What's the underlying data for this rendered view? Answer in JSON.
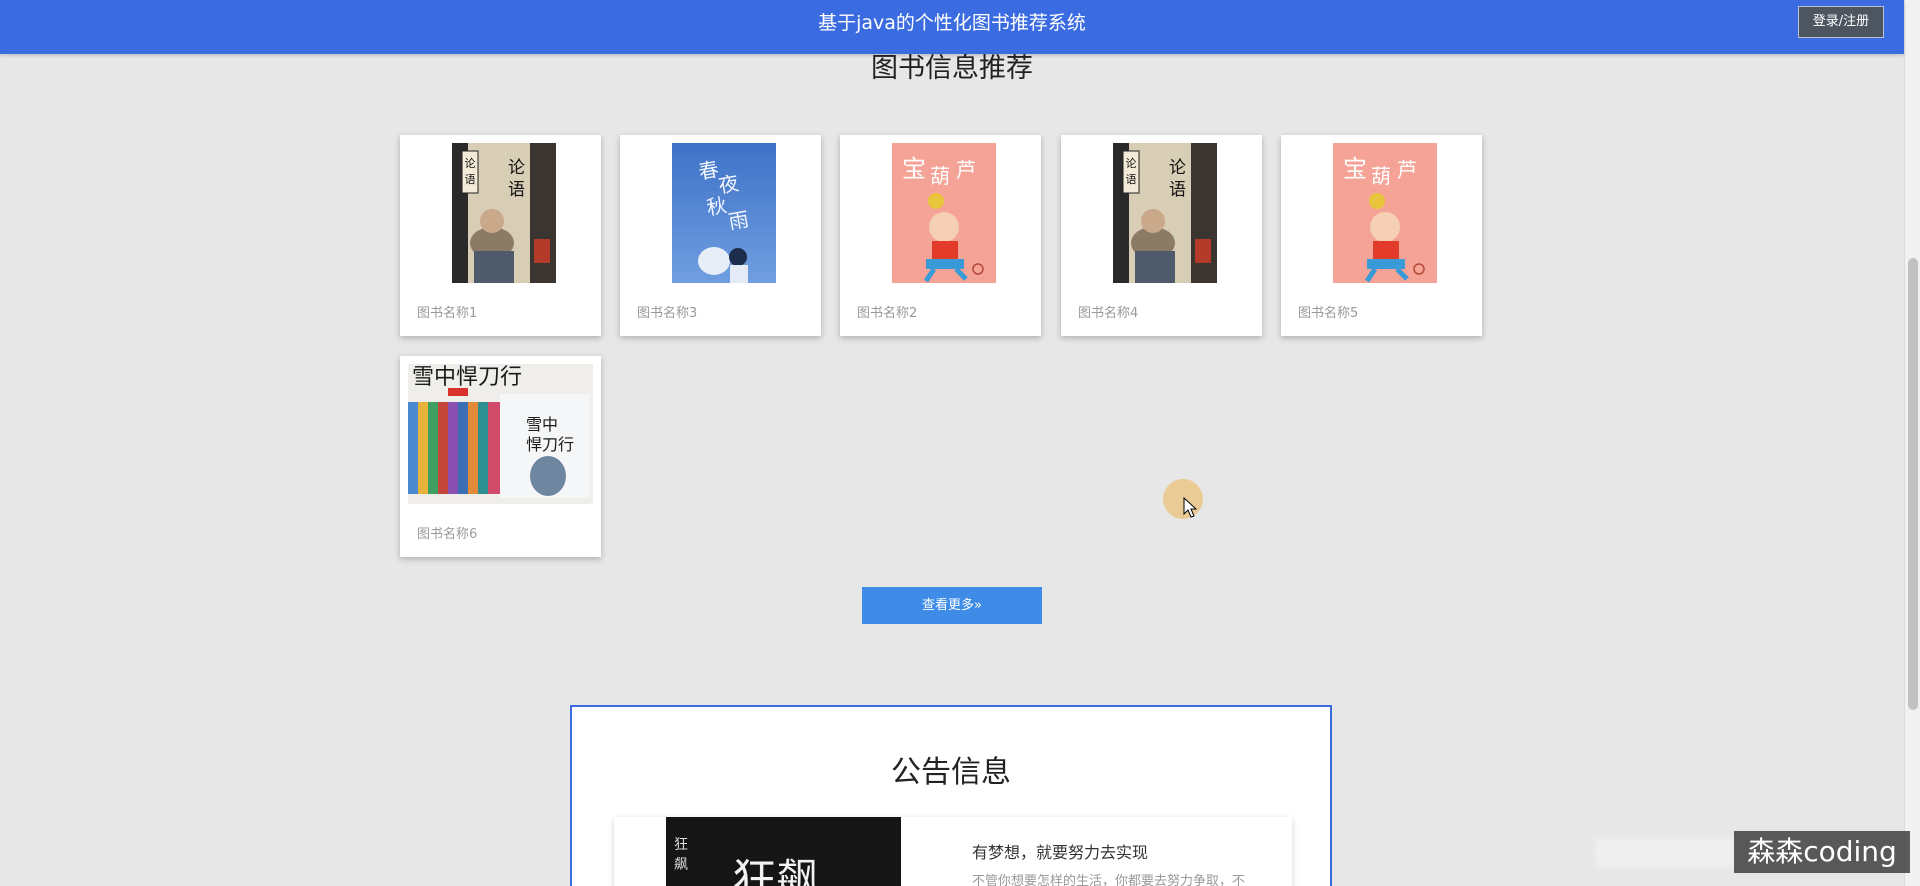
{
  "header": {
    "title": "基于java的个性化图书推荐系统",
    "login_label": "登录/注册",
    "bar_color": "#3a6be0"
  },
  "recommend": {
    "title": "图书信息推荐",
    "books": [
      {
        "name": "图书名称1",
        "cover": "lunyu-book-cover"
      },
      {
        "name": "图书名称3",
        "cover": "chunjiu-qiuyu-book-cover"
      },
      {
        "name": "图书名称2",
        "cover": "calabash-book-cover"
      },
      {
        "name": "图书名称4",
        "cover": "lunyu-book-cover"
      },
      {
        "name": "图书名称5",
        "cover": "calabash-book-cover"
      },
      {
        "name": "图书名称6",
        "cover": "xuezhong-dao-boxset-cover"
      }
    ],
    "more_label": "查看更多",
    "more_icon": "double-chevron-right-icon"
  },
  "notice": {
    "title": "公告信息",
    "item": {
      "headline": "有梦想，就要努力去实现",
      "excerpt": "不管你想要怎样的生活，你都要去努力争取，不"
    }
  },
  "watermark": "森森coding",
  "accent_color": "#3e8be8"
}
